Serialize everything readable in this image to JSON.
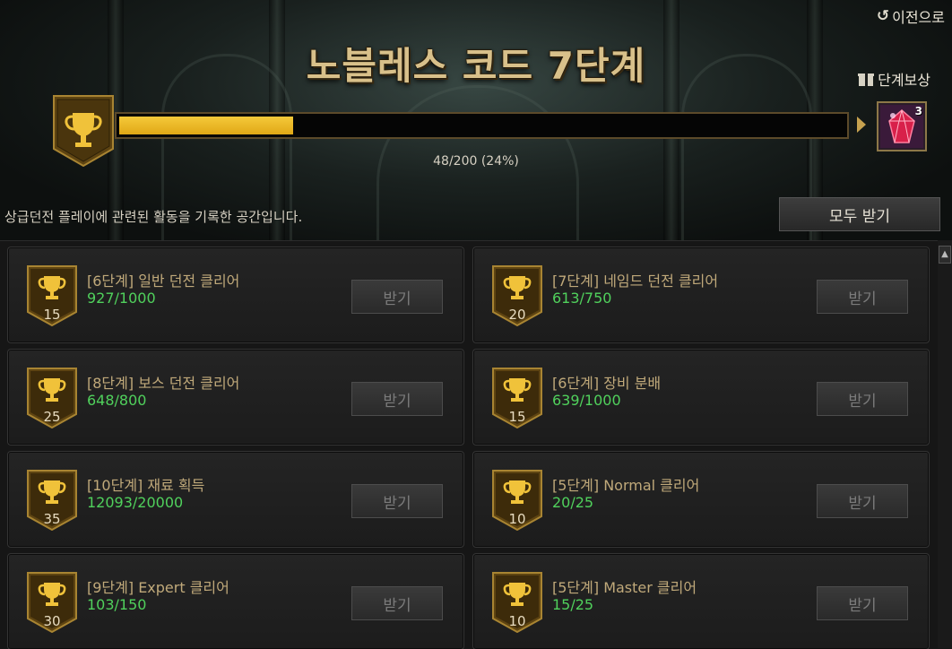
{
  "header": {
    "back_label": "이전으로",
    "title": "노블레스 코드 7단계",
    "stage_reward_label": "단계보상",
    "progress_text": "48/200 (24%)",
    "progress_fraction": 0.24,
    "reward_count": "3",
    "description": "상급던전 플레이에 관련된 활동을 기록한 공간입니다.",
    "claim_all_label": "모두 받기"
  },
  "colors": {
    "accent_gold": "#c7a24f",
    "progress_fill": "#f5c93a",
    "progress_green": "#50d15c"
  },
  "missions": [
    {
      "points": "15",
      "title": "[6단계] 일반 던전 클리어",
      "progress": "927/1000",
      "button": "받기"
    },
    {
      "points": "20",
      "title": "[7단계] 네임드 던전 클리어",
      "progress": "613/750",
      "button": "받기"
    },
    {
      "points": "25",
      "title": "[8단계] 보스 던전 클리어",
      "progress": "648/800",
      "button": "받기"
    },
    {
      "points": "15",
      "title": "[6단계] 장비 분배",
      "progress": "639/1000",
      "button": "받기"
    },
    {
      "points": "35",
      "title": "[10단계] 재료 획득",
      "progress": "12093/20000",
      "button": "받기"
    },
    {
      "points": "10",
      "title": "[5단계] Normal 클리어",
      "progress": "20/25",
      "button": "받기"
    },
    {
      "points": "30",
      "title": "[9단계] Expert 클리어",
      "progress": "103/150",
      "button": "받기"
    },
    {
      "points": "10",
      "title": "[5단계] Master 클리어",
      "progress": "15/25",
      "button": "받기"
    }
  ]
}
